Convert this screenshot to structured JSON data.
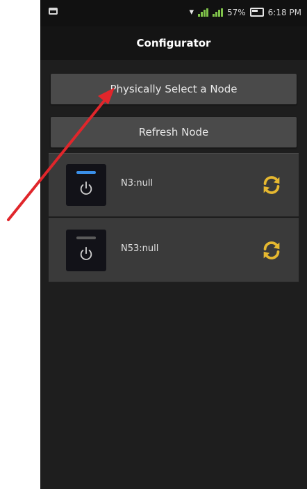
{
  "status_bar": {
    "battery": "57%",
    "time": "6:18 PM"
  },
  "header": {
    "title": "Configurator"
  },
  "buttons": {
    "select_label": "Physically Select a Node",
    "refresh_label": "Refresh Node"
  },
  "nodes": [
    {
      "label": "N3:null",
      "led_color": "#3a8fe8"
    },
    {
      "label": "N53:null",
      "led_color": "#5a5a5a"
    }
  ],
  "colors": {
    "arrow": "#e0262b",
    "refresh_icon": "#e6b830"
  }
}
